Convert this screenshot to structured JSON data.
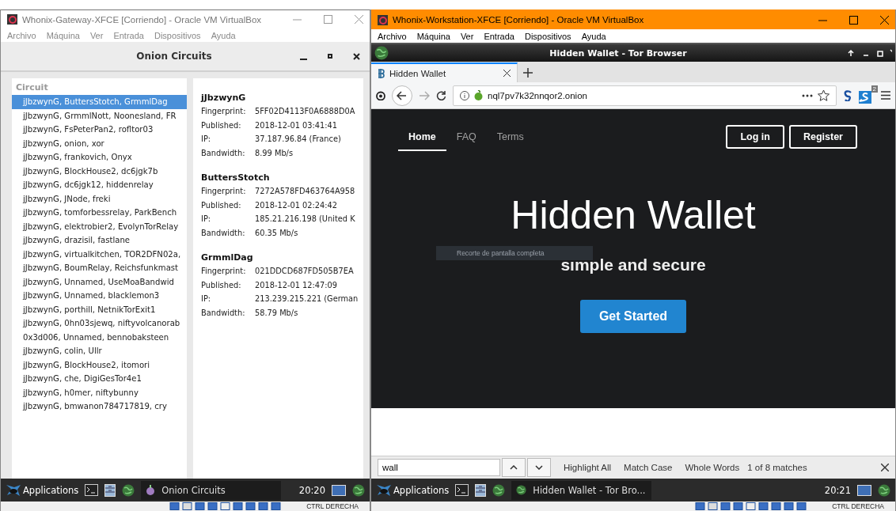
{
  "gateway_window": {
    "title": "Whonix-Gateway-XFCE [Corriendo] - Oracle VM VirtualBox",
    "active": false,
    "menu": [
      "Archivo",
      "Máquina",
      "Ver",
      "Entrada",
      "Dispositivos",
      "Ayuda"
    ],
    "app_title": "Onion Circuits",
    "circuit_list": {
      "heading": "Circuit",
      "items": [
        {
          "label": "jJbzwynG, ButtersStotch, GrmmlDag",
          "selected": true
        },
        {
          "label": "jJbzwynG, GrmmlNott, Noonesland, FR",
          "selected": false
        },
        {
          "label": "jJbzwynG, FsPeterPan2, rofltor03",
          "selected": false
        },
        {
          "label": "jJbzwynG, onion, xor",
          "selected": false
        },
        {
          "label": "jJbzwynG, frankovich, Onyx",
          "selected": false
        },
        {
          "label": "jJbzwynG, BlockHouse2, dc6jgk7b",
          "selected": false
        },
        {
          "label": "jJbzwynG, dc6jgk12, hiddenrelay",
          "selected": false
        },
        {
          "label": "jJbzwynG, JNode, freki",
          "selected": false
        },
        {
          "label": "jJbzwynG, tomforbessrelay, ParkBench",
          "selected": false
        },
        {
          "label": "jJbzwynG, elektrobier2, EvolynTorRelay",
          "selected": false
        },
        {
          "label": "jJbzwynG, drazisil, fastlane",
          "selected": false
        },
        {
          "label": "jJbzwynG, virtualkitchen, TOR2DFN02a,",
          "selected": false
        },
        {
          "label": "jJbzwynG, BoumRelay, Reichsfunkmast",
          "selected": false
        },
        {
          "label": "jJbzwynG, Unnamed, UseMoaBandwid",
          "selected": false
        },
        {
          "label": "jJbzwynG, Unnamed, blacklemon3",
          "selected": false
        },
        {
          "label": "jJbzwynG, porthill, NetnikTorExit1",
          "selected": false
        },
        {
          "label": "jJbzwynG, 0hn03sjewq, niftyvolcanorab",
          "selected": false
        },
        {
          "label": "0x3d006, Unnamed, bennobaksteen",
          "selected": false
        },
        {
          "label": "jJbzwynG, colin, Ullr",
          "selected": false
        },
        {
          "label": "jJbzwynG, BlockHouse2, itomori",
          "selected": false
        },
        {
          "label": "jJbzwynG, che, DigiGesTor4e1",
          "selected": false
        },
        {
          "label": "jJbzwynG, h0mer, niftybunny",
          "selected": false
        },
        {
          "label": "jJbzwynG, bmwanon784717819, cry",
          "selected": false
        }
      ]
    },
    "details": [
      {
        "name": "jJbzwynG",
        "fields": [
          {
            "label": "Fingerprint:",
            "value": "5FF02D4113F0A6888D0A"
          },
          {
            "label": "Published:",
            "value": "2018-12-01 03:41:41"
          },
          {
            "label": "IP:",
            "value": "37.187.96.84 (France)"
          },
          {
            "label": "Bandwidth:",
            "value": "8.99 Mb/s"
          }
        ]
      },
      {
        "name": "ButtersStotch",
        "fields": [
          {
            "label": "Fingerprint:",
            "value": "7272A578FD463764A958"
          },
          {
            "label": "Published:",
            "value": "2018-12-01 02:24:42"
          },
          {
            "label": "IP:",
            "value": "185.21.216.198 (United K"
          },
          {
            "label": "Bandwidth:",
            "value": "60.35 Mb/s"
          }
        ]
      },
      {
        "name": "GrmmlDag",
        "fields": [
          {
            "label": "Fingerprint:",
            "value": "021DDCD687FD505B7EA"
          },
          {
            "label": "Published:",
            "value": "2018-12-01 12:47:09"
          },
          {
            "label": "IP:",
            "value": "213.239.215.221 (German"
          },
          {
            "label": "Bandwidth:",
            "value": "58.79 Mb/s"
          }
        ]
      }
    ],
    "taskbar": {
      "applications": "Applications",
      "task": "Onion Circuits",
      "clock": "20:20"
    },
    "host_key": "CTRL DERECHA"
  },
  "workstation_window": {
    "title": "Whonix-Workstation-XFCE [Corriendo] - Oracle VM VirtualBox",
    "active": true,
    "menu": [
      "Archivo",
      "Máquina",
      "Ver",
      "Entrada",
      "Dispositivos",
      "Ayuda"
    ],
    "browser_title": "Hidden Wallet - Tor Browser",
    "tabs": [
      {
        "label": "Hidden Wallet",
        "selected": true
      }
    ],
    "url": "nql7pv7k32nnqor2.onion",
    "extension_badge": "2",
    "page": {
      "nav": [
        {
          "label": "Home",
          "selected": true
        },
        {
          "label": "FAQ",
          "selected": false
        },
        {
          "label": "Terms",
          "selected": false
        }
      ],
      "buttons": [
        "Log in",
        "Register"
      ],
      "heading": "Hidden Wallet",
      "subheading": "simple and secure",
      "cta": "Get Started"
    },
    "overlay_tooltip": "Recorte de pantalla completa",
    "find_bar": {
      "value": "wall",
      "options": [
        "Highlight All",
        "Match Case",
        "Whole Words"
      ],
      "result": "1 of 8 matches"
    },
    "taskbar": {
      "applications": "Applications",
      "task": "Hidden Wallet - Tor Bro...",
      "clock": "20:21"
    },
    "host_key": "CTRL DERECHA"
  }
}
